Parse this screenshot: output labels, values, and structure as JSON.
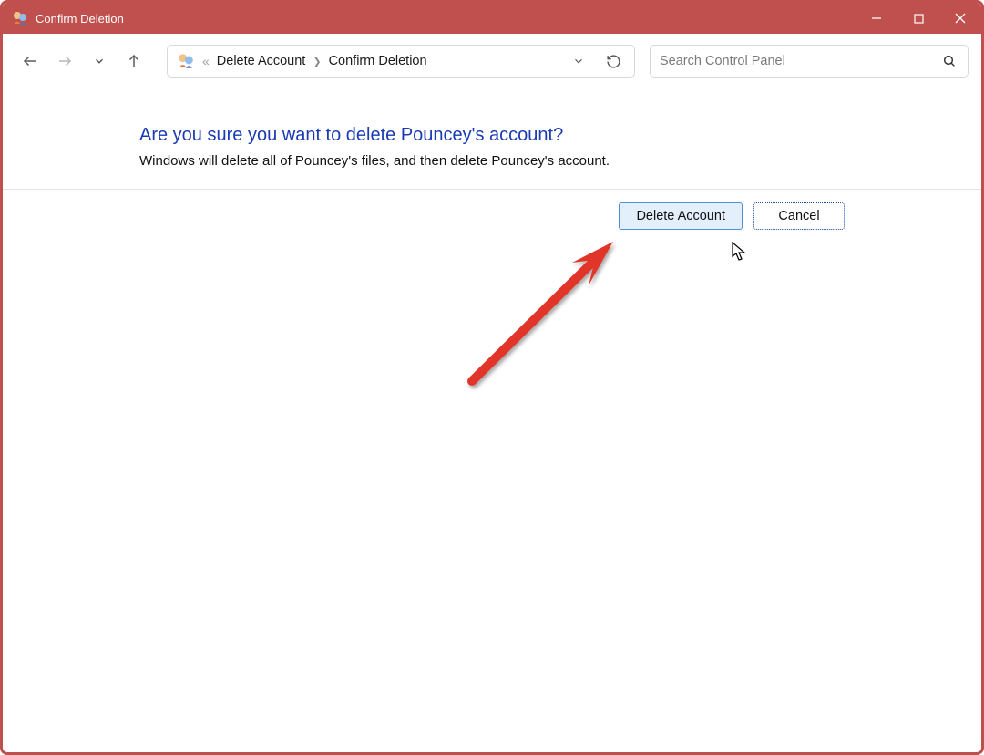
{
  "title": "Confirm Deletion",
  "breadcrumb": {
    "prev": "Delete Account",
    "current": "Confirm Deletion"
  },
  "search": {
    "placeholder": "Search Control Panel"
  },
  "heading": "Are you sure you want to delete Pouncey's account?",
  "body": "Windows will delete all of Pouncey's files, and then delete Pouncey's account.",
  "actions": {
    "primary": "Delete Account",
    "secondary": "Cancel"
  }
}
